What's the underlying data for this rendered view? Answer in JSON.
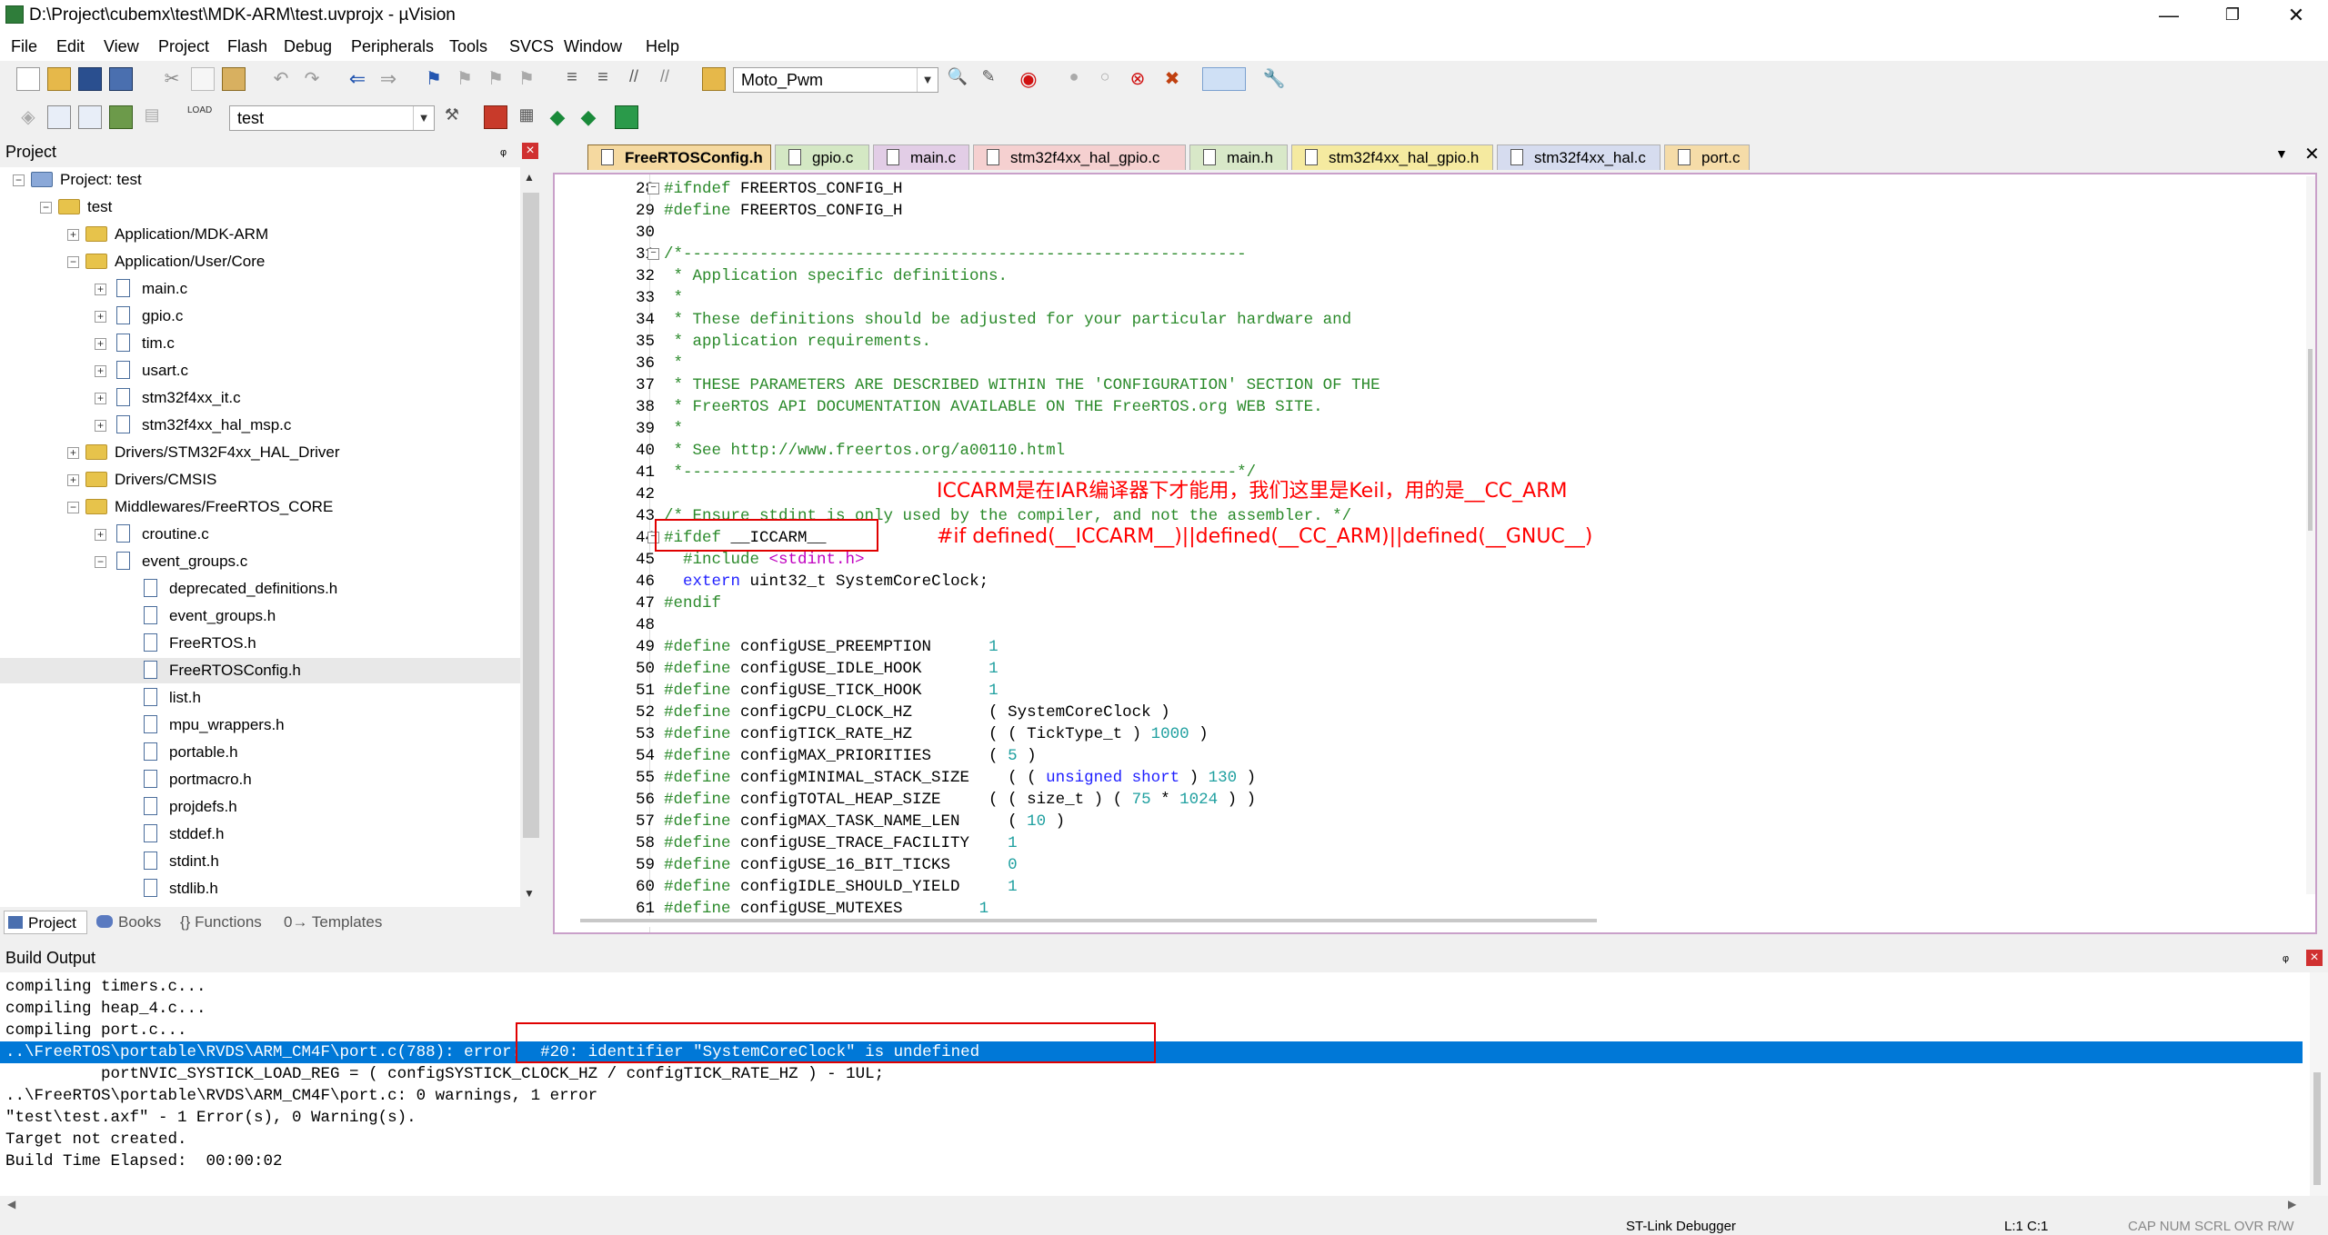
{
  "window": {
    "title": "D:\\Project\\cubemx\\test\\MDK-ARM\\test.uvprojx - µVision",
    "minimize": "—",
    "maximize": "❐",
    "close": "✕"
  },
  "menu": [
    "File",
    "Edit",
    "View",
    "Project",
    "Flash",
    "Debug",
    "Peripherals",
    "Tools",
    "SVCS",
    "Window",
    "Help"
  ],
  "toolbar": {
    "target_combo": "Moto_Pwm",
    "project_combo": "test"
  },
  "project_panel": {
    "title": "Project",
    "pin": "ᵩ",
    "close": "×",
    "tree": [
      {
        "label": "Project: test",
        "level": 0,
        "kind": "root",
        "exp": "−"
      },
      {
        "label": "test",
        "level": 1,
        "kind": "target",
        "exp": "−"
      },
      {
        "label": "Application/MDK-ARM",
        "level": 2,
        "kind": "folder",
        "exp": "+"
      },
      {
        "label": "Application/User/Core",
        "level": 2,
        "kind": "folder",
        "exp": "−"
      },
      {
        "label": "main.c",
        "level": 3,
        "kind": "file",
        "exp": "+"
      },
      {
        "label": "gpio.c",
        "level": 3,
        "kind": "file",
        "exp": "+"
      },
      {
        "label": "tim.c",
        "level": 3,
        "kind": "file",
        "exp": "+"
      },
      {
        "label": "usart.c",
        "level": 3,
        "kind": "file",
        "exp": "+"
      },
      {
        "label": "stm32f4xx_it.c",
        "level": 3,
        "kind": "file",
        "exp": "+"
      },
      {
        "label": "stm32f4xx_hal_msp.c",
        "level": 3,
        "kind": "file",
        "exp": "+"
      },
      {
        "label": "Drivers/STM32F4xx_HAL_Driver",
        "level": 2,
        "kind": "folder",
        "exp": "+"
      },
      {
        "label": "Drivers/CMSIS",
        "level": 2,
        "kind": "folder",
        "exp": "+"
      },
      {
        "label": "Middlewares/FreeRTOS_CORE",
        "level": 2,
        "kind": "folder",
        "exp": "−"
      },
      {
        "label": "croutine.c",
        "level": 3,
        "kind": "file",
        "exp": "+"
      },
      {
        "label": "event_groups.c",
        "level": 3,
        "kind": "file",
        "exp": "−"
      },
      {
        "label": "deprecated_definitions.h",
        "level": 4,
        "kind": "file",
        "exp": ""
      },
      {
        "label": "event_groups.h",
        "level": 4,
        "kind": "file",
        "exp": ""
      },
      {
        "label": "FreeRTOS.h",
        "level": 4,
        "kind": "file",
        "exp": ""
      },
      {
        "label": "FreeRTOSConfig.h",
        "level": 4,
        "kind": "file",
        "exp": "",
        "selected": true
      },
      {
        "label": "list.h",
        "level": 4,
        "kind": "file",
        "exp": ""
      },
      {
        "label": "mpu_wrappers.h",
        "level": 4,
        "kind": "file",
        "exp": ""
      },
      {
        "label": "portable.h",
        "level": 4,
        "kind": "file",
        "exp": ""
      },
      {
        "label": "portmacro.h",
        "level": 4,
        "kind": "file",
        "exp": ""
      },
      {
        "label": "projdefs.h",
        "level": 4,
        "kind": "file",
        "exp": ""
      },
      {
        "label": "stddef.h",
        "level": 4,
        "kind": "file",
        "exp": ""
      },
      {
        "label": "stdint.h",
        "level": 4,
        "kind": "file",
        "exp": ""
      },
      {
        "label": "stdlib.h",
        "level": 4,
        "kind": "file",
        "exp": ""
      }
    ],
    "tabs": [
      "Project",
      "Books",
      "{} Functions",
      "0→ Templates"
    ]
  },
  "editor_tabs": [
    {
      "label": "FreeRTOSConfig.h",
      "color": "#f5d9a0",
      "active": true
    },
    {
      "label": "gpio.c",
      "color": "#d4e8c4"
    },
    {
      "label": "main.c",
      "color": "#e2cde6"
    },
    {
      "label": "stm32f4xx_hal_gpio.c",
      "color": "#f5d0d0"
    },
    {
      "label": "main.h",
      "color": "#d8e8c8"
    },
    {
      "label": "stm32f4xx_hal_gpio.h",
      "color": "#f5eaa0"
    },
    {
      "label": "stm32f4xx_hal.c",
      "color": "#d6dcef"
    },
    {
      "label": "port.c",
      "color": "#f5dca8"
    }
  ],
  "code_lines": [
    {
      "n": "28",
      "fold": "−",
      "html": "<span class='pp'>#ifndef</span> FREERTOS_CONFIG_H"
    },
    {
      "n": "29",
      "html": "<span class='pp'>#define</span> FREERTOS_CONFIG_H"
    },
    {
      "n": "30",
      "html": ""
    },
    {
      "n": "31",
      "fold": "−",
      "html": "<span class='cm'>/*-----------------------------------------------------------</span>"
    },
    {
      "n": "32",
      "html": "<span class='cm'> * Application specific definitions.</span>"
    },
    {
      "n": "33",
      "html": "<span class='cm'> *</span>"
    },
    {
      "n": "34",
      "html": "<span class='cm'> * These definitions should be adjusted for your particular hardware and</span>"
    },
    {
      "n": "35",
      "html": "<span class='cm'> * application requirements.</span>"
    },
    {
      "n": "36",
      "html": "<span class='cm'> *</span>"
    },
    {
      "n": "37",
      "html": "<span class='cm'> * THESE PARAMETERS ARE DESCRIBED WITHIN THE 'CONFIGURATION' SECTION OF THE</span>"
    },
    {
      "n": "38",
      "html": "<span class='cm'> * FreeRTOS API DOCUMENTATION AVAILABLE ON THE FreeRTOS.org WEB SITE.</span>"
    },
    {
      "n": "39",
      "html": "<span class='cm'> *</span>"
    },
    {
      "n": "40",
      "html": "<span class='cm'> * See http://www.freertos.org/a00110.html</span>"
    },
    {
      "n": "41",
      "html": "<span class='cm'> *----------------------------------------------------------*/</span>"
    },
    {
      "n": "42",
      "html": ""
    },
    {
      "n": "43",
      "html": "<span class='cm'>/* Ensure stdint is only used by the compiler, and not the assembler. */</span>"
    },
    {
      "n": "44",
      "fold": "−",
      "html": "<span class='pp'>#ifdef</span> __ICCARM__"
    },
    {
      "n": "45",
      "html": "  <span class='pp'>#include</span> <span class='str'>&lt;stdint.h&gt;</span>"
    },
    {
      "n": "46",
      "html": "  <span class='kw'>extern</span> uint32_t SystemCoreClock;"
    },
    {
      "n": "47",
      "html": "<span class='pp'>#endif</span>"
    },
    {
      "n": "48",
      "html": ""
    },
    {
      "n": "49",
      "html": "<span class='pp'>#define</span> configUSE_PREEMPTION      <span class='num'>1</span>"
    },
    {
      "n": "50",
      "html": "<span class='pp'>#define</span> configUSE_IDLE_HOOK       <span class='num'>1</span>"
    },
    {
      "n": "51",
      "html": "<span class='pp'>#define</span> configUSE_TICK_HOOK       <span class='num'>1</span>"
    },
    {
      "n": "52",
      "html": "<span class='pp'>#define</span> configCPU_CLOCK_HZ        ( SystemCoreClock )"
    },
    {
      "n": "53",
      "html": "<span class='pp'>#define</span> configTICK_RATE_HZ        ( ( TickType_t ) <span class='num'>1000</span> )"
    },
    {
      "n": "54",
      "html": "<span class='pp'>#define</span> configMAX_PRIORITIES      ( <span class='num'>5</span> )"
    },
    {
      "n": "55",
      "html": "<span class='pp'>#define</span> configMINIMAL_STACK_SIZE    ( ( <span class='kw'>unsigned short</span> ) <span class='num'>130</span> )"
    },
    {
      "n": "56",
      "html": "<span class='pp'>#define</span> configTOTAL_HEAP_SIZE     ( ( size_t ) ( <span class='num'>75</span> * <span class='num'>1024</span> ) )"
    },
    {
      "n": "57",
      "html": "<span class='pp'>#define</span> configMAX_TASK_NAME_LEN     ( <span class='num'>10</span> )"
    },
    {
      "n": "58",
      "html": "<span class='pp'>#define</span> configUSE_TRACE_FACILITY    <span class='num'>1</span>"
    },
    {
      "n": "59",
      "html": "<span class='pp'>#define</span> configUSE_16_BIT_TICKS      <span class='num'>0</span>"
    },
    {
      "n": "60",
      "html": "<span class='pp'>#define</span> configIDLE_SHOULD_YIELD     <span class='num'>1</span>"
    },
    {
      "n": "61",
      "html": "<span class='pp'>#define</span> configUSE_MUTEXES        <span class='num'>1</span>"
    }
  ],
  "annotations": {
    "note1": "ICCARM是在IAR编译器下才能用，我们这里是Keil，用的是__CC_ARM",
    "note2": "#if defined(__ICCARM__)||defined(__CC_ARM)||defined(__GNUC__)"
  },
  "build_output": {
    "title": "Build Output",
    "lines": [
      "compiling timers.c...",
      "compiling heap_4.c...",
      "compiling port.c...",
      "..\\FreeRTOS\\portable\\RVDS\\ARM_CM4F\\port.c(788): error:  #20: identifier \"SystemCoreClock\" is undefined",
      "          portNVIC_SYSTICK_LOAD_REG = ( configSYSTICK_CLOCK_HZ / configTICK_RATE_HZ ) - 1UL;",
      "..\\FreeRTOS\\portable\\RVDS\\ARM_CM4F\\port.c: 0 warnings, 1 error",
      "\"test\\test.axf\" - 1 Error(s), 0 Warning(s).",
      "Target not created.",
      "Build Time Elapsed:  00:00:02"
    ],
    "selected_index": 3
  },
  "status": {
    "debugger": "ST-Link Debugger",
    "position": "L:1 C:1",
    "caps": "CAP  NUM  SCRL  OVR  R/W"
  }
}
